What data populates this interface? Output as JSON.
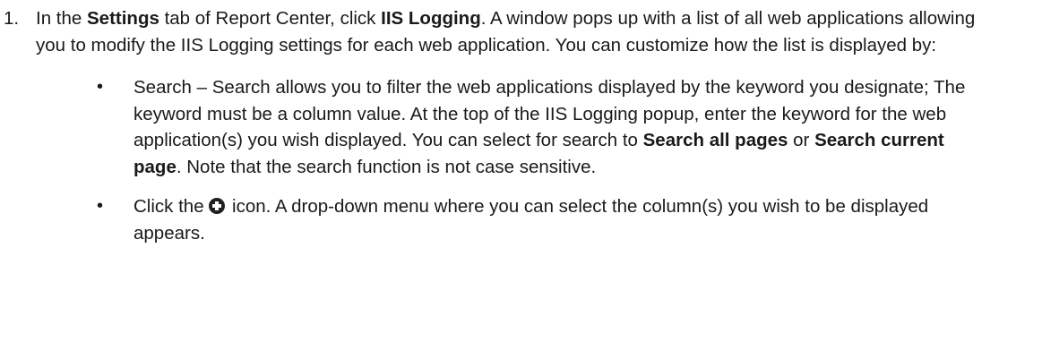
{
  "step": {
    "number": "1.",
    "t1": "In the ",
    "b1": "Settings",
    "t2": " tab of Report Center, click ",
    "b2": "IIS Logging",
    "t3": ". A window pops up with a list of all web applications allowing you to modify the IIS Logging settings for each web application. You can customize how the list is displayed by:"
  },
  "bullets": {
    "glyph": "•",
    "search": {
      "t1": "Search – Search allows you to filter the web applications displayed by the keyword you designate; The keyword must be a column value. At the top of the IIS Logging popup, enter the keyword for the web application(s) you wish displayed. You can select for search to ",
      "b1": "Search all pages",
      "t2": " or ",
      "b2": "Search current page",
      "t3": ". Note that the search function is not case sensitive."
    },
    "columns": {
      "t1": "Click the ",
      "icon": "plus-circle-icon",
      "t2": " icon. A drop-down menu where you can select the column(s) you wish to be displayed appears."
    }
  }
}
